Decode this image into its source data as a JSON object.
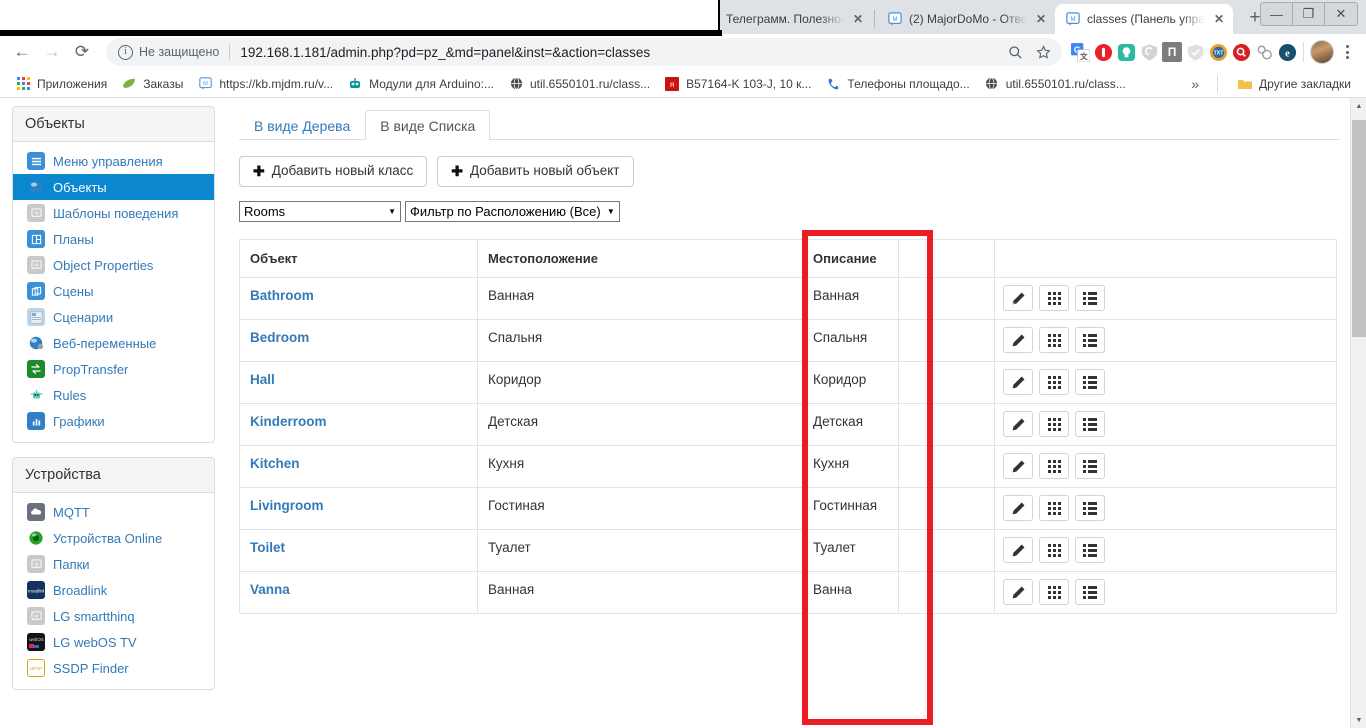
{
  "browser": {
    "tabs": [
      {
        "title": "Телеграмм. Полезное",
        "active": false,
        "favicon": "none"
      },
      {
        "title": "(2) MajorDoMo - Отве",
        "active": false,
        "favicon": "majordomo-icon"
      },
      {
        "title": "classes (Панель упра",
        "active": true,
        "favicon": "majordomo-icon"
      }
    ],
    "new_tab_label": "+",
    "close_label": "✕",
    "window_controls": {
      "minimize": "—",
      "maximize": "❐",
      "close": "✕"
    },
    "nav": {
      "back": "←",
      "forward": "→",
      "reload": "⟳"
    },
    "omnibox": {
      "security_text": "Не защищено",
      "url": "192.168.1.181/admin.php?pd=pz_&md=panel&inst=&action=classes",
      "zoom_icon": "search-icon",
      "bookmark_icon": "star-icon"
    },
    "extensions": [
      {
        "name": "google-translate-icon",
        "glyph": "G",
        "color": "#ffffff",
        "text": "#4285f4"
      },
      {
        "name": "adblock-icon",
        "glyph": "",
        "color": "#e03131",
        "text": "#ffffff"
      },
      {
        "name": "lamp-icon",
        "glyph": "",
        "color": "#2cb9a0",
        "text": "#ffffff"
      },
      {
        "name": "shield-gray-icon",
        "glyph": "",
        "color": "#c9cdd1",
        "text": "#ffffff"
      },
      {
        "name": "p-letter-icon",
        "glyph": "П",
        "color": "#7d7d7d",
        "text": "#ffffff"
      },
      {
        "name": "shield-check-icon",
        "glyph": "✓",
        "color": "#d8dcdf",
        "text": "#ffffff"
      },
      {
        "name": "txt-coin-icon",
        "glyph": "TXT",
        "color": "#f0a830",
        "text": "#ffffff"
      },
      {
        "name": "search-red-icon",
        "glyph": "",
        "color": "#d81f26",
        "text": "#ffffff"
      },
      {
        "name": "rings-icon",
        "glyph": "",
        "color": "#ffffff",
        "text": "#9aa0a6"
      },
      {
        "name": "evernote-icon",
        "glyph": "e",
        "color": "#18506b",
        "text": "#ffffff"
      }
    ],
    "bookmarks": [
      {
        "label": "Приложения",
        "icon": "apps-grid-icon",
        "color": "#4285f4"
      },
      {
        "label": "Заказы",
        "icon": "leaf-icon",
        "color": "#7cb342"
      },
      {
        "label": "https://kb.mjdm.ru/v...",
        "icon": "majordomo-icon",
        "color": "#5b9bd5"
      },
      {
        "label": "Модули для Arduino:...",
        "icon": "robot-icon",
        "color": "#00979d"
      },
      {
        "label": "util.6550101.ru/class...",
        "icon": "globe-icon",
        "color": "#555555"
      },
      {
        "label": "B57164-K 103-J, 10 к...",
        "icon": "red-square-icon",
        "color": "#cc0000"
      },
      {
        "label": "Телефоны площадо...",
        "icon": "phone-icon",
        "color": "#3b6fd4"
      },
      {
        "label": "util.6550101.ru/class...",
        "icon": "globe-icon",
        "color": "#555555"
      }
    ],
    "bookmarks_overflow": "»",
    "other_bookmarks": {
      "label": "Другие закладки",
      "icon": "folder-icon",
      "color": "#f2c14e"
    }
  },
  "sidebar": {
    "panels": [
      {
        "title": "Объекты",
        "items": [
          {
            "label": "Меню управления",
            "icon": "menu-icon",
            "color": "#3b8fd4",
            "glyph": "≡",
            "active": false
          },
          {
            "label": "Объекты",
            "icon": "sphere-icon",
            "color": "#1b6ec2",
            "glyph": "◍",
            "active": true
          },
          {
            "label": "Шаблоны поведения",
            "icon": "majordomo-gray-icon",
            "color": "#c6c6c6",
            "glyph": "M",
            "active": false
          },
          {
            "label": "Планы",
            "icon": "plan-icon",
            "color": "#3b8fd4",
            "glyph": "⊞",
            "active": false
          },
          {
            "label": "Object Properties",
            "icon": "majordomo-gray-icon",
            "color": "#c6c6c6",
            "glyph": "M",
            "active": false
          },
          {
            "label": "Сцены",
            "icon": "scenes-icon",
            "color": "#3b8fd4",
            "glyph": "❐",
            "active": false
          },
          {
            "label": "Сценарии",
            "icon": "script-icon",
            "color": "#b9ccdd",
            "glyph": "▤",
            "active": false
          },
          {
            "label": "Веб-переменные",
            "icon": "web-sphere-icon",
            "color": "#2f80c8",
            "glyph": "◍",
            "active": false
          },
          {
            "label": "PropTransfer",
            "icon": "transfer-icon",
            "color": "#1e8c2e",
            "glyph": "⇄",
            "active": false
          },
          {
            "label": "Rules",
            "icon": "robot-icon",
            "color": "#7ed6c4",
            "glyph": "⚇",
            "active": false
          },
          {
            "label": "Графики",
            "icon": "chart-icon",
            "color": "#2f80c8",
            "glyph": "▮",
            "active": false
          }
        ]
      },
      {
        "title": "Устройства",
        "items": [
          {
            "label": "MQTT",
            "icon": "mqtt-icon",
            "color": "#6b6f80",
            "glyph": "☁",
            "active": false
          },
          {
            "label": "Устройства Online",
            "icon": "green-ball-icon",
            "color": "#1e9e2e",
            "glyph": "●",
            "active": false
          },
          {
            "label": "Папки",
            "icon": "majordomo-gray-icon",
            "color": "#c6c6c6",
            "glyph": "M",
            "active": false
          },
          {
            "label": "Broadlink",
            "icon": "broadlink-icon",
            "color": "#15325e",
            "glyph": "b",
            "active": false
          },
          {
            "label": "LG smartthinq",
            "icon": "majordomo-gray-icon",
            "color": "#c6c6c6",
            "glyph": "M",
            "active": false
          },
          {
            "label": "LG webOS TV",
            "icon": "webos-tv-icon",
            "color": "#1a1a1a",
            "glyph": "▰",
            "active": false
          },
          {
            "label": "SSDP Finder",
            "icon": "upnp-icon",
            "color": "#ffffff",
            "glyph": "UPnP",
            "active": false
          }
        ]
      }
    ]
  },
  "main": {
    "tabs": [
      {
        "label": "В виде Дерева",
        "active": false
      },
      {
        "label": "В виде Списка",
        "active": true
      }
    ],
    "buttons": [
      {
        "label": "Добавить новый класс",
        "icon": "plus-icon"
      },
      {
        "label": "Добавить новый объект",
        "icon": "plus-icon"
      }
    ],
    "filters": [
      {
        "name": "class-select",
        "value": "Rooms",
        "arrow": "▼"
      },
      {
        "name": "location-filter-select",
        "value": "Фильтр по Расположению (Все)",
        "arrow": "▼"
      }
    ],
    "table": {
      "headers": [
        "Объект",
        "Местоположение",
        "Описание",
        "",
        ""
      ],
      "rows": [
        {
          "object": "Bathroom",
          "location": "Ванная",
          "description": "Ванная"
        },
        {
          "object": "Bedroom",
          "location": "Спальня",
          "description": "Спальня"
        },
        {
          "object": "Hall",
          "location": "Коридор",
          "description": "Коридор"
        },
        {
          "object": "Kinderroom",
          "location": "Детская",
          "description": "Детская"
        },
        {
          "object": "Kitchen",
          "location": "Кухня",
          "description": "Кухня"
        },
        {
          "object": "Livingroom",
          "location": "Гостиная",
          "description": "Гостинная"
        },
        {
          "object": "Toilet",
          "location": "Туалет",
          "description": "Туалет"
        },
        {
          "object": "Vanna",
          "location": "Ванная",
          "description": "Ванна"
        }
      ],
      "row_actions": [
        {
          "name": "edit-button",
          "icon": "pencil-icon"
        },
        {
          "name": "grid-view-button",
          "icon": "grid-icon"
        },
        {
          "name": "list-view-button",
          "icon": "list-icon"
        }
      ]
    }
  },
  "annotation": {
    "highlight_color": "#ec1c24",
    "target_column": "Описание"
  }
}
